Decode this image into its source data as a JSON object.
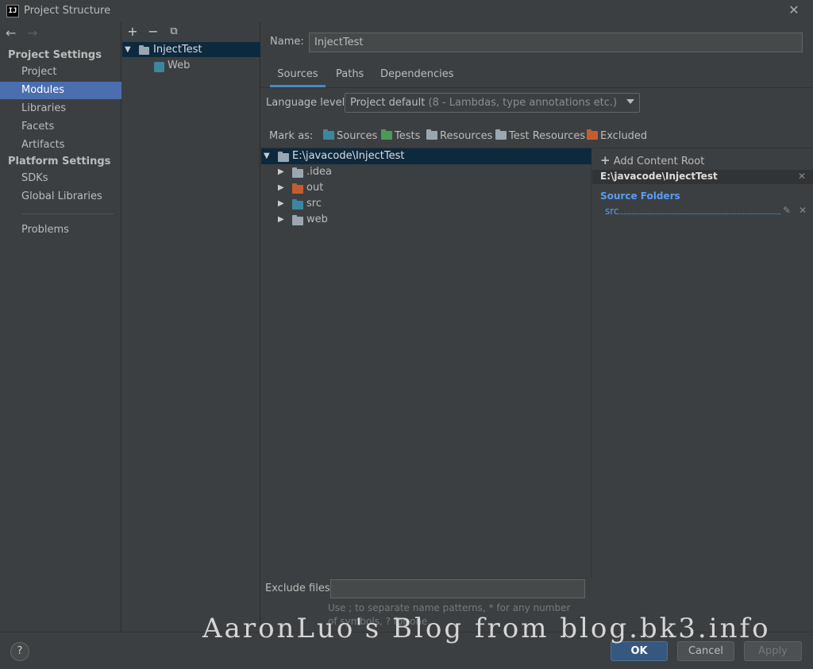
{
  "window": {
    "title": "Project Structure",
    "app_icon_text": "IJ",
    "close_icon": "close-icon"
  },
  "nav": {
    "back_icon": "←",
    "forward_icon": "→",
    "project_settings_label": "Project Settings",
    "project_items": [
      "Project",
      "Modules",
      "Libraries",
      "Facets",
      "Artifacts"
    ],
    "selected": "Modules",
    "platform_settings_label": "Platform Settings",
    "platform_items": [
      "SDKs",
      "Global Libraries"
    ],
    "problems_label": "Problems"
  },
  "modules": {
    "toolbar": {
      "add": "+",
      "remove": "−",
      "copy": "⧉"
    },
    "root": "InjectTest",
    "children": [
      "Web"
    ]
  },
  "module": {
    "name_label": "Name:",
    "name_value": "InjectTest",
    "tabs": [
      "Sources",
      "Paths",
      "Dependencies"
    ],
    "active_tab": "Sources",
    "language_level_label": "Language level:",
    "language_level_value": "Project default",
    "language_level_hint": "(8 - Lambdas, type annotations etc.)",
    "mark_as_label": "Mark as:",
    "mark_as": [
      {
        "label": "Sources",
        "color": "#3e86a0"
      },
      {
        "label": "Tests",
        "color": "#499c54"
      },
      {
        "label": "Resources",
        "color": "#9aa7b0"
      },
      {
        "label": "Test Resources",
        "color": "#9aa7b0"
      },
      {
        "label": "Excluded",
        "color": "#c55c2f"
      }
    ]
  },
  "dir_tree": {
    "root": "E:\\javacode\\InjectTest",
    "children": [
      {
        "name": ".idea",
        "color": "#9aa7b0"
      },
      {
        "name": "out",
        "color": "#c55c2f"
      },
      {
        "name": "src",
        "color": "#3e86a0"
      },
      {
        "name": "web",
        "color": "#9aa7b0"
      }
    ]
  },
  "content_root": {
    "add_label": "Add Content Root",
    "path": "E:\\javacode\\InjectTest",
    "source_folders_label": "Source Folders",
    "source_folders": [
      "src"
    ]
  },
  "exclude": {
    "label": "Exclude files:",
    "value": "",
    "hint": "Use ; to separate name patterns, * for any number of symbols, ? for one."
  },
  "buttons": {
    "help": "?",
    "ok": "OK",
    "cancel": "Cancel",
    "apply": "Apply"
  },
  "watermark": "AaronLuo's Blog from blog.bk3.info"
}
